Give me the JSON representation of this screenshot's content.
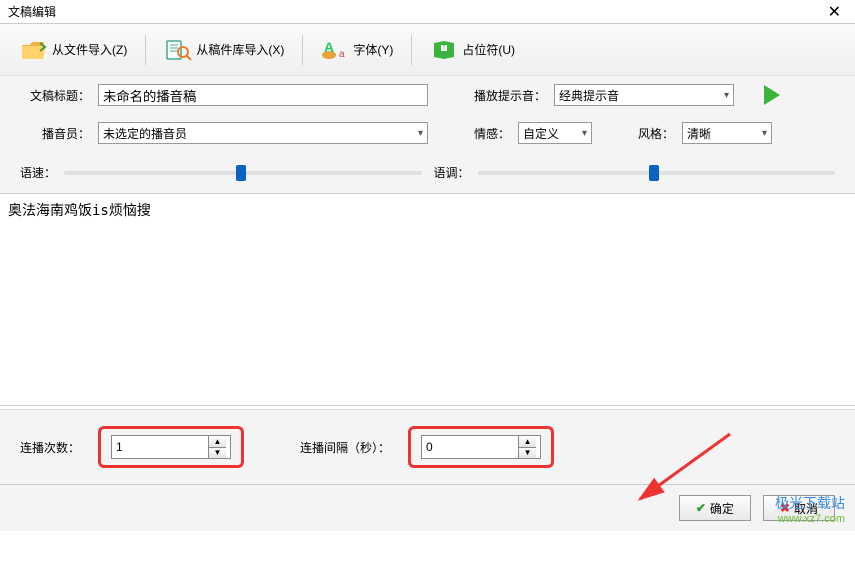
{
  "window": {
    "title": "文稿编辑"
  },
  "toolbar": {
    "import_file": "从文件导入(Z)",
    "import_lib": "从稿件库导入(X)",
    "font": "字体(Y)",
    "placeholder": "占位符(U)"
  },
  "form": {
    "title_label": "文稿标题：",
    "title_value": "未命名的播音稿",
    "sound_label": "播放提示音：",
    "sound_value": "经典提示音",
    "announcer_label": "播音员：",
    "announcer_value": "未选定的播音员",
    "emotion_label": "情感：",
    "emotion_value": "自定义",
    "style_label": "风格：",
    "style_value": "清晰",
    "speed_label": "语速：",
    "tone_label": "语调："
  },
  "content": {
    "text": "奥法海南鸡饭is烦恼搜"
  },
  "repeat": {
    "count_label": "连播次数：",
    "count_value": "1",
    "interval_label": "连播间隔（秒）：",
    "interval_value": "0"
  },
  "footer": {
    "ok": "确定",
    "cancel": "取消"
  },
  "watermark": {
    "text": "极光下载站",
    "url": "www.xz7.com"
  }
}
